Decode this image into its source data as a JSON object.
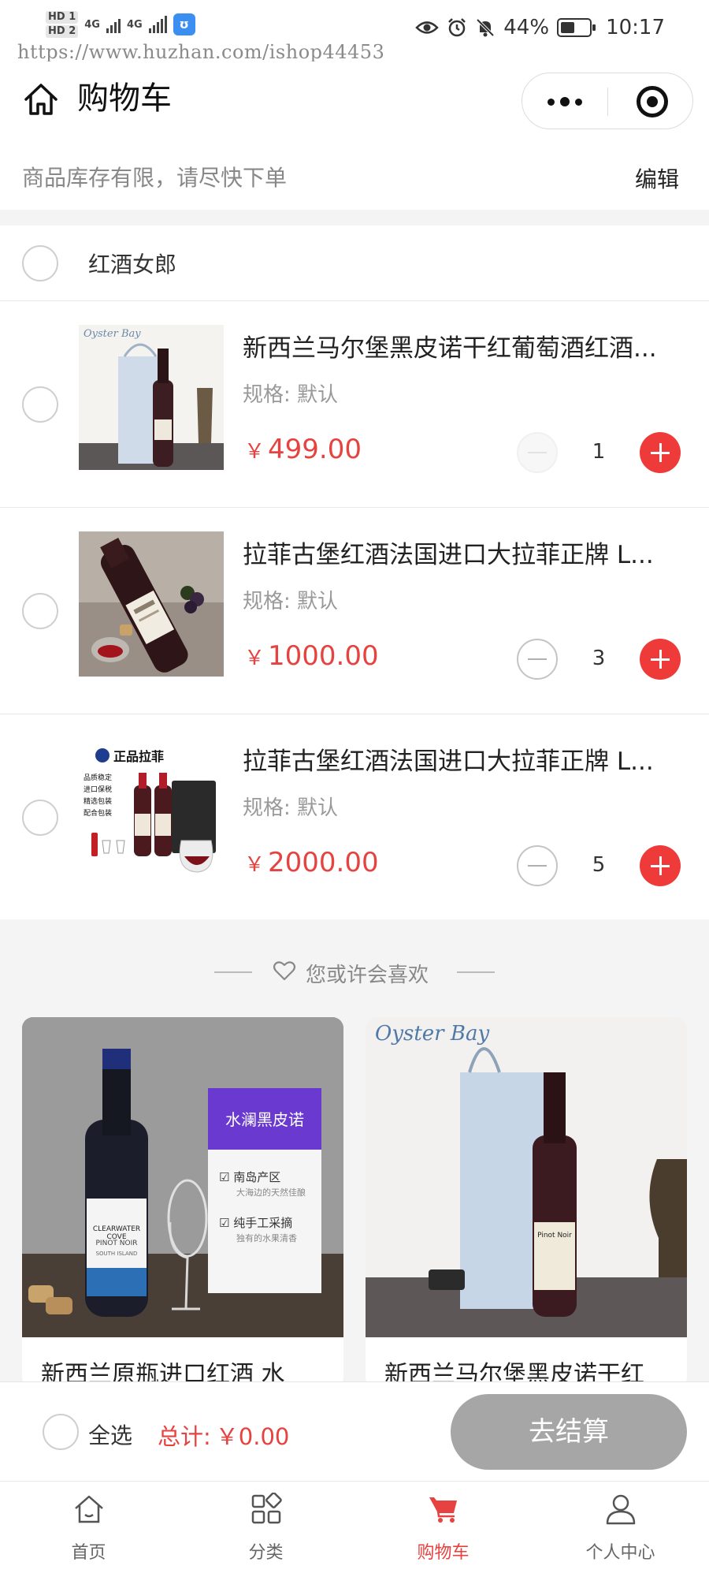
{
  "status_bar": {
    "sim1": "HD 1",
    "sim2": "HD 2",
    "net1": "4G",
    "net2": "4G",
    "app_icon": "ʊ",
    "battery": "44%",
    "time": "10:17",
    "icons": [
      "eye-icon",
      "alarm-icon",
      "mute-icon",
      "battery-icon"
    ]
  },
  "watermark": "https://www.huzhan.com/ishop44453",
  "nav": {
    "title": "购物车",
    "home_icon": "home-icon",
    "more_icon": "more-dots-icon",
    "close_icon": "target-icon"
  },
  "notice": {
    "text": "商品库存有限，请尽快下单",
    "edit": "编辑"
  },
  "store": {
    "name": "红酒女郎"
  },
  "items": [
    {
      "title": "新西兰马尔堡黑皮诺干红葡萄酒红酒...",
      "spec": "规格: 默认",
      "currency": "￥",
      "price": "499.00",
      "qty": "1",
      "minus_disabled": true
    },
    {
      "title": "拉菲古堡红酒法国进口大拉菲正牌 L...",
      "spec": "规格: 默认",
      "currency": "￥",
      "price": "1000.00",
      "qty": "3",
      "minus_disabled": false
    },
    {
      "title": "拉菲古堡红酒法国进口大拉菲正牌 L...",
      "spec": "规格: 默认",
      "currency": "￥",
      "price": "2000.00",
      "qty": "5",
      "minus_disabled": false
    }
  ],
  "item_images": {
    "oyster_brand": "Oyster Bay",
    "oyster_wine": "Pinot Noir",
    "lafite_badge": "正品拉菲",
    "lafite_points": [
      "品质稳定",
      "进口保税",
      "精选包装",
      "配合包装"
    ]
  },
  "recommend": {
    "title": "您或许会喜欢",
    "cards": [
      {
        "title": "新西兰原瓶进口红酒 水",
        "img_brand": "CLEARWATER COVE",
        "img_sub": "PINOT NOIR",
        "img_region": "SOUTH ISLAND",
        "panel_title": "水澜黑皮诺",
        "feature1": "南岛产区",
        "feature1_sub": "大海边的天然佳酿",
        "feature2": "纯手工采摘",
        "feature2_sub": "独有的水果清香"
      },
      {
        "title": "新西兰马尔堡黑皮诺干红",
        "img_brand": "Oyster Bay",
        "img_wine": "Pinot Noir"
      }
    ]
  },
  "settle": {
    "select_all": "全选",
    "total_label": "总计:",
    "total_value": "￥0.00",
    "checkout": "去结算"
  },
  "tabs": [
    {
      "label": "首页",
      "icon": "home-icon",
      "active": false
    },
    {
      "label": "分类",
      "icon": "category-icon",
      "active": false
    },
    {
      "label": "购物车",
      "icon": "cart-icon",
      "active": true
    },
    {
      "label": "个人中心",
      "icon": "user-icon",
      "active": false
    }
  ],
  "colors": {
    "accent": "#e64340",
    "plus_button": "#ef3a3a",
    "checkout_disabled": "#a6a6a6",
    "background_gray": "#f4f4f4"
  }
}
